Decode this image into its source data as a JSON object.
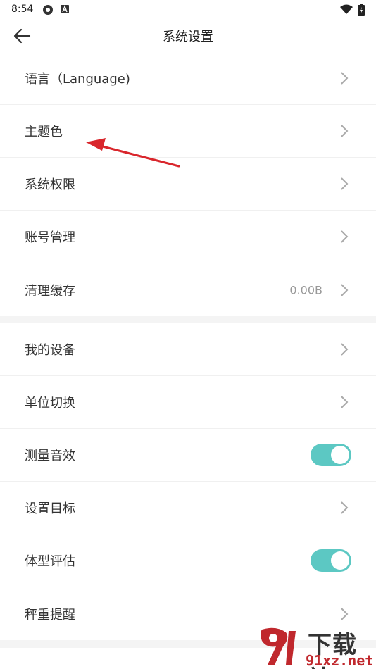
{
  "status_bar": {
    "time": "8:54",
    "icons": [
      "gear-icon",
      "a-badge-icon",
      "wifi-icon",
      "battery-icon"
    ]
  },
  "header": {
    "title": "系统设置",
    "back_icon": "back-arrow-icon"
  },
  "groups": [
    {
      "items": [
        {
          "label": "语言（Language)",
          "control": "chevron"
        },
        {
          "label": "主题色",
          "control": "chevron"
        },
        {
          "label": "系统权限",
          "control": "chevron"
        },
        {
          "label": "账号管理",
          "control": "chevron"
        },
        {
          "label": "清理缓存",
          "control": "chevron",
          "value": "0.00B"
        }
      ]
    },
    {
      "items": [
        {
          "label": "我的设备",
          "control": "chevron"
        },
        {
          "label": "单位切换",
          "control": "chevron"
        },
        {
          "label": "测量音效",
          "control": "toggle",
          "on": true
        },
        {
          "label": "设置目标",
          "control": "chevron"
        },
        {
          "label": "体型评估",
          "control": "toggle",
          "on": true
        },
        {
          "label": "秤重提醒",
          "control": "chevron"
        }
      ]
    }
  ],
  "annotation": {
    "type": "red-arrow",
    "points_to": "主题色",
    "color": "#d9262c"
  },
  "watermark": {
    "chinese": "下载站",
    "site": "91xz.net",
    "logo_color": "#c0282d"
  },
  "colors": {
    "toggle_on": "#5cc8c3",
    "background": "#f4f4f4",
    "chevron": "#aaaaaa"
  }
}
